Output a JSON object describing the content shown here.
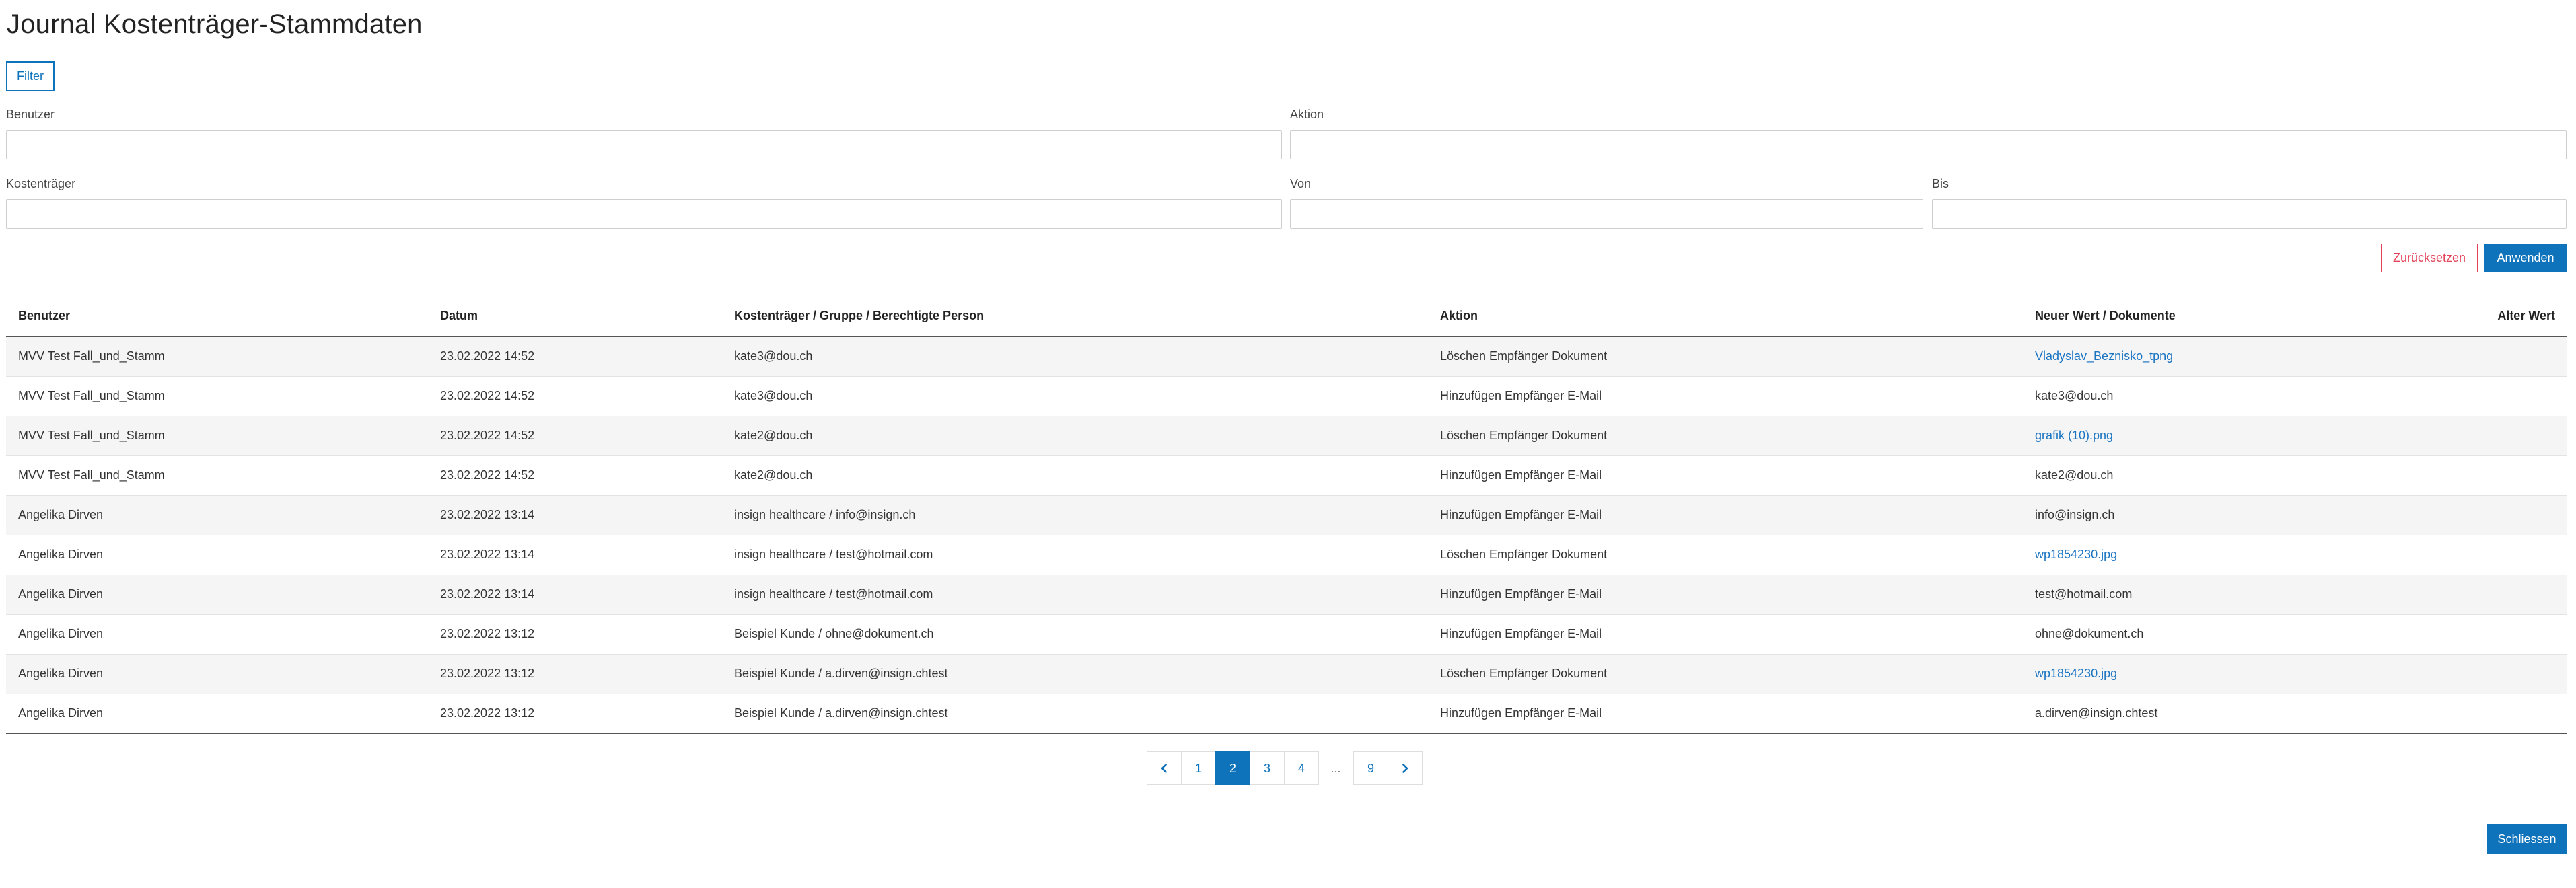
{
  "page": {
    "title": "Journal Kostenträger-Stammdaten"
  },
  "filter": {
    "toggle_label": "Filter",
    "benutzer_label": "Benutzer",
    "benutzer_value": "",
    "aktion_label": "Aktion",
    "aktion_value": "",
    "kostentraeger_label": "Kostenträger",
    "kostentraeger_value": "",
    "von_label": "Von",
    "von_value": "",
    "bis_label": "Bis",
    "bis_value": "",
    "reset_label": "Zurücksetzen",
    "apply_label": "Anwenden"
  },
  "table": {
    "headers": {
      "benutzer": "Benutzer",
      "datum": "Datum",
      "kostentraeger": "Kostenträger / Gruppe / Berechtigte Person",
      "aktion": "Aktion",
      "neuer_wert": "Neuer Wert / Dokumente",
      "alter_wert": "Alter Wert"
    },
    "rows": [
      {
        "benutzer": "MVV Test Fall_und_Stamm",
        "datum": "23.02.2022 14:52",
        "kostentraeger": "kate3@dou.ch",
        "aktion": "Löschen Empfänger Dokument",
        "neuer_wert": "Vladyslav_Beznisko_tpng",
        "alter_wert": ""
      },
      {
        "benutzer": "MVV Test Fall_und_Stamm",
        "datum": "23.02.2022 14:52",
        "kostentraeger": "kate3@dou.ch",
        "aktion": "Hinzufügen Empfänger E-Mail",
        "neuer_wert": "kate3@dou.ch",
        "alter_wert": ""
      },
      {
        "benutzer": "MVV Test Fall_und_Stamm",
        "datum": "23.02.2022 14:52",
        "kostentraeger": "kate2@dou.ch",
        "aktion": "Löschen Empfänger Dokument",
        "neuer_wert": "grafik (10).png",
        "alter_wert": ""
      },
      {
        "benutzer": "MVV Test Fall_und_Stamm",
        "datum": "23.02.2022 14:52",
        "kostentraeger": "kate2@dou.ch",
        "aktion": "Hinzufügen Empfänger E-Mail",
        "neuer_wert": "kate2@dou.ch",
        "alter_wert": ""
      },
      {
        "benutzer": "Angelika Dirven",
        "datum": "23.02.2022 13:14",
        "kostentraeger": "insign healthcare / info@insign.ch",
        "aktion": "Hinzufügen Empfänger E-Mail",
        "neuer_wert": "info@insign.ch",
        "alter_wert": ""
      },
      {
        "benutzer": "Angelika Dirven",
        "datum": "23.02.2022 13:14",
        "kostentraeger": "insign healthcare / test@hotmail.com",
        "aktion": "Löschen Empfänger Dokument",
        "neuer_wert": "wp1854230.jpg",
        "alter_wert": ""
      },
      {
        "benutzer": "Angelika Dirven",
        "datum": "23.02.2022 13:14",
        "kostentraeger": "insign healthcare / test@hotmail.com",
        "aktion": "Hinzufügen Empfänger E-Mail",
        "neuer_wert": "test@hotmail.com",
        "alter_wert": ""
      },
      {
        "benutzer": "Angelika Dirven",
        "datum": "23.02.2022 13:12",
        "kostentraeger": "Beispiel Kunde / ohne@dokument.ch",
        "aktion": "Hinzufügen Empfänger E-Mail",
        "neuer_wert": "ohne@dokument.ch",
        "alter_wert": ""
      },
      {
        "benutzer": "Angelika Dirven",
        "datum": "23.02.2022 13:12",
        "kostentraeger": "Beispiel Kunde / a.dirven@insign.chtest",
        "aktion": "Löschen Empfänger Dokument",
        "neuer_wert": "wp1854230.jpg",
        "alter_wert": ""
      },
      {
        "benutzer": "Angelika Dirven",
        "datum": "23.02.2022 13:12",
        "kostentraeger": "Beispiel Kunde / a.dirven@insign.chtest",
        "aktion": "Hinzufügen Empfänger E-Mail",
        "neuer_wert": "a.dirven@insign.chtest",
        "alter_wert": ""
      }
    ]
  },
  "pagination": {
    "prev_icon": "chevron-left-icon",
    "next_icon": "chevron-right-icon",
    "pages": [
      "1",
      "2",
      "3",
      "4",
      "...",
      "9"
    ],
    "current": "2"
  },
  "footer": {
    "close_label": "Schliessen"
  },
  "colors": {
    "primary": "#0e73bb",
    "danger": "#e2435a",
    "link": "#1a74c2"
  }
}
